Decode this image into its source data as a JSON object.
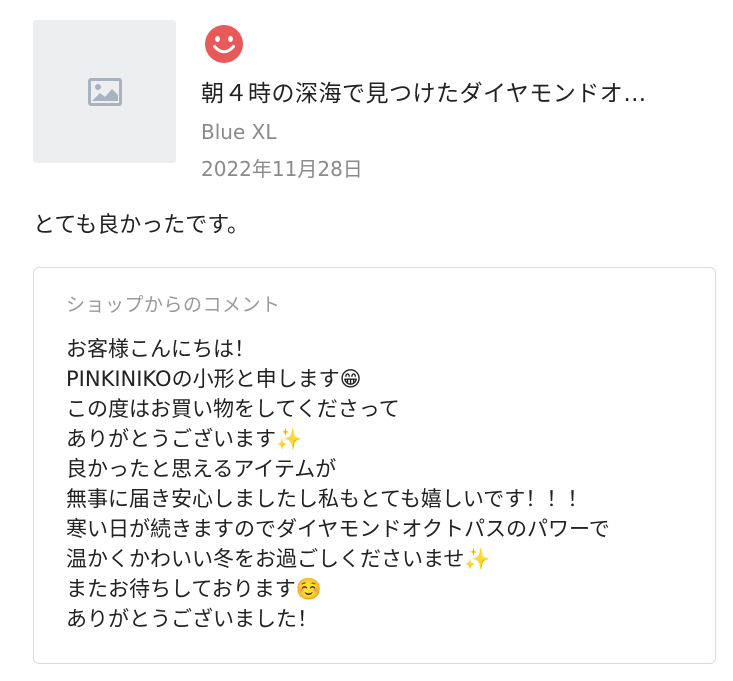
{
  "review": {
    "thumbnail_icon": "image-placeholder-icon",
    "rating_icon": "smiley-face-icon",
    "rating_color": "#e85a5a",
    "product_title": "朝４時の深海で見つけたダイヤモンドオ…",
    "variant": "Blue XL",
    "date": "2022年11月28日",
    "text": "とても良かったです。"
  },
  "shop_comment": {
    "heading": "ショップからのコメント",
    "lines": [
      "お客様こんにちは！",
      "PINKINIKOの小形と申します😁",
      "この度はお買い物をしてくださって",
      "ありがとうございます✨",
      "良かったと思えるアイテムが",
      "無事に届き安心しましたし私もとても嬉しいです！！！",
      "寒い日が続きますのでダイヤモンドオクトパスのパワーで",
      "温かくかわいい冬をお過ごしくださいませ✨",
      "またお待ちしております☺️",
      "ありがとうございました！"
    ]
  }
}
